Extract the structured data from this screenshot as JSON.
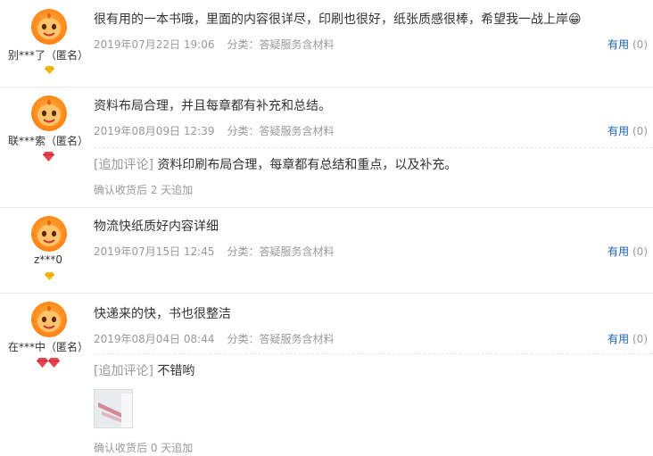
{
  "colors": {
    "link": "#1a62b8",
    "meta": "#999999",
    "text": "#333333",
    "divider": "#e6e6e6"
  },
  "reviews": [
    {
      "user": "别***了（匿名）",
      "avatar_icon": "orange-mascot-avatar-icon",
      "badge_icon": "gold-diamond-icon",
      "content": "很有用的一本书哦，里面的内容很详尽，印刷也很好，纸张质感很棒，希望我一战上岸😁",
      "date": "2019年07月22日 19:06",
      "category": "分类：答疑服务含材料",
      "useful_label": "有用",
      "useful_count": "(0)"
    },
    {
      "user": "联***索（匿名）",
      "avatar_icon": "orange-mascot-avatar-icon",
      "badge_icon": "red-diamond-icon",
      "content": "资料布局合理，并且每章都有补充和总结。",
      "date": "2019年08月09日 12:39",
      "category": "分类：答疑服务含材料",
      "useful_label": "有用",
      "useful_count": "(0)",
      "additional": {
        "tag": "[追加评论]",
        "text": "资料印刷布局合理，每章都有总结和重点，以及补充。",
        "after": "确认收货后 2 天追加"
      }
    },
    {
      "user": "z***0",
      "avatar_icon": "orange-mascot-avatar-icon",
      "badge_icon": "gold-diamond-icon",
      "content": "物流快纸质好内容详细",
      "date": "2019年07月15日 12:45",
      "category": "分类：答疑服务含材料",
      "useful_label": "有用",
      "useful_count": "(0)"
    },
    {
      "user": "在***中（匿名）",
      "avatar_icon": "orange-mascot-avatar-icon",
      "badge_icon": "double-red-diamond-icon",
      "content": "快递来的快，书也很整洁",
      "date": "2019年08月04日 08:44",
      "category": "分类：答疑服务含材料",
      "useful_label": "有用",
      "useful_count": "(0)",
      "additional": {
        "tag": "[追加评论]",
        "text": "不错哟",
        "after": "确认收货后 0 天追加",
        "image_icon": "review-photo-thumbnail"
      }
    }
  ]
}
